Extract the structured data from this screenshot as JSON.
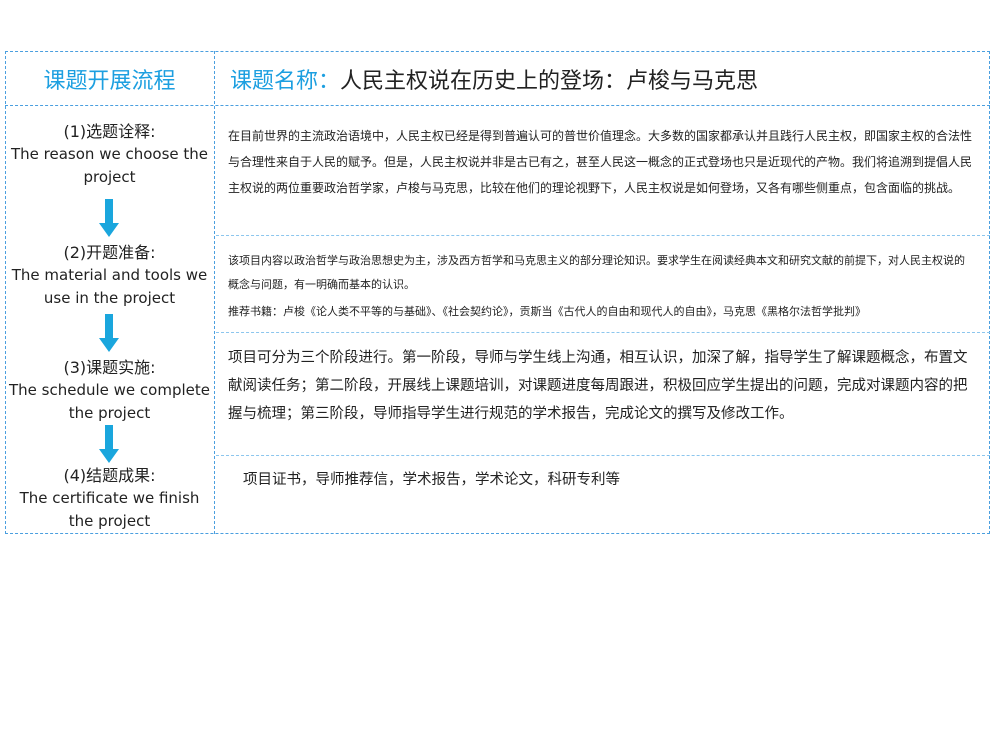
{
  "header": {
    "left_title": "课题开展流程",
    "right_label": "课题名称：",
    "right_title": "人民主权说在历史上的登场：卢梭与马克思"
  },
  "steps": [
    {
      "cn": "(1)选题诠释:",
      "en": "The reason we choose the project"
    },
    {
      "cn": "(2)开题准备:",
      "en": "The material and tools we use in the project"
    },
    {
      "cn": "(3)课题实施:",
      "en": "The schedule we complete the project"
    },
    {
      "cn": "(4)结题成果:",
      "en": "The certificate we finish the project"
    }
  ],
  "content": {
    "reason": "在目前世界的主流政治语境中，人民主权已经是得到普遍认可的普世价值理念。大多数的国家都承认并且践行人民主权，即国家主权的合法性与合理性来自于人民的赋予。但是，人民主权说并非是古已有之，甚至人民这一概念的正式登场也只是近现代的产物。我们将追溯到提倡人民主权说的两位重要政治哲学家，卢梭与马克思，比较在他们的理论视野下，人民主权说是如何登场，又各有哪些侧重点，包含面临的挑战。",
    "preparation": "该项目内容以政治哲学与政治思想史为主，涉及西方哲学和马克思主义的部分理论知识。要求学生在阅读经典本文和研究文献的前提下，对人民主权说的概念与问题，有一明确而基本的认识。",
    "books": "推荐书籍：卢梭《论人类不平等的与基础》、《社会契约论》，贡斯当《古代人的自由和现代人的自由》，马克思《黑格尔法哲学批判》",
    "schedule": "项目可分为三个阶段进行。第一阶段，导师与学生线上沟通，相互认识，加深了解，指导学生了解课题概念，布置文献阅读任务；第二阶段，开展线上课题培训，对课题进度每周跟进，积极回应学生提出的问题，完成对课题内容的把握与梳理；第三阶段，导师指导学生进行规范的学术报告，完成论文的撰写及修改工作。",
    "result": "项目证书，导师推荐信，学术报告，学术论文，科研专利等"
  },
  "colors": {
    "accent": "#1c9fe0",
    "arrow": "#1aa6dd",
    "border": "#4a9fdf"
  }
}
